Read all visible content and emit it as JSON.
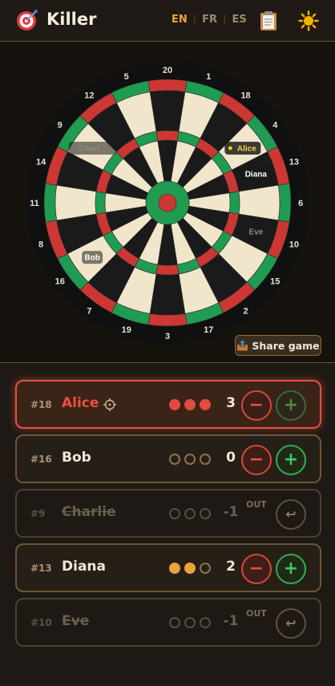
{
  "app": {
    "title": "Killer",
    "logo_icon": "dartboard-target-icon"
  },
  "header": {
    "languages": [
      {
        "code": "EN",
        "active": true
      },
      {
        "code": "FR",
        "active": false
      },
      {
        "code": "ES",
        "active": false
      }
    ],
    "clipboard_icon": "clipboard-icon",
    "theme_icon": "sun-icon"
  },
  "board": {
    "numbers": [
      20,
      1,
      18,
      4,
      13,
      6,
      10,
      15,
      2,
      17,
      3,
      19,
      7,
      16,
      8,
      11,
      14,
      9,
      12,
      5
    ],
    "markers": [
      {
        "name": "Alice",
        "number": 4,
        "active": true
      },
      {
        "name": "Charl...",
        "number": 9,
        "active": false
      },
      {
        "name": "Diana",
        "number": 13,
        "active": false
      },
      {
        "name": "Eve",
        "number": 10,
        "active": false
      },
      {
        "name": "Bob",
        "number": 16,
        "active": false
      }
    ],
    "colors": {
      "red": "#cc3733",
      "green": "#1f9c52",
      "cream": "#f1e6cb",
      "black": "#1a1a1a"
    }
  },
  "share_button": {
    "icon": "share-outbox-icon",
    "label": "Share game"
  },
  "players": [
    {
      "segment": "#18",
      "name": "Alice",
      "lives": "3",
      "dots": [
        "red",
        "red",
        "red"
      ],
      "status": "active",
      "out_label": ""
    },
    {
      "segment": "#16",
      "name": "Bob",
      "lives": "0",
      "dots": [
        "empty",
        "empty",
        "empty"
      ],
      "status": "normal",
      "out_label": ""
    },
    {
      "segment": "#9",
      "name": "Charlie",
      "lives": "-1",
      "dots": [
        "empty",
        "empty",
        "empty"
      ],
      "status": "out",
      "out_label": "OUT"
    },
    {
      "segment": "#13",
      "name": "Diana",
      "lives": "2",
      "dots": [
        "gold",
        "gold",
        "empty"
      ],
      "status": "normal",
      "out_label": ""
    },
    {
      "segment": "#10",
      "name": "Eve",
      "lives": "-1",
      "dots": [
        "empty",
        "empty",
        "empty"
      ],
      "status": "out",
      "out_label": "OUT"
    }
  ],
  "controls": {
    "minus": "−",
    "plus": "+",
    "undo": "↩"
  }
}
